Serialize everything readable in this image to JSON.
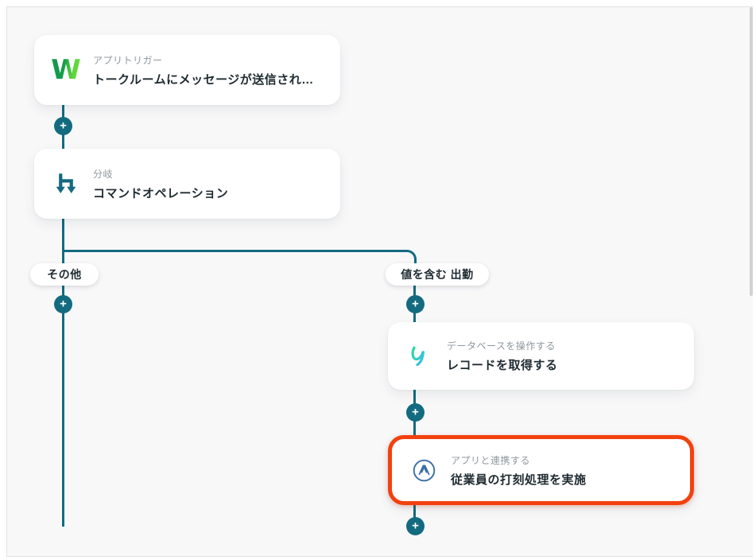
{
  "colors": {
    "accent_teal": "#136B80",
    "highlight_red": "#F2410F",
    "canvas_bg": "#F8F8F9",
    "card_bg": "#FFFFFF",
    "category_text": "#8F989D",
    "title_text": "#1F2B31"
  },
  "icons": {
    "plus": "+",
    "lineworks_glyph": "W"
  },
  "nodes": [
    {
      "icon": "lineworks-icon",
      "category": "アプリトリガー",
      "title": "トークルームにメッセージが送信され…"
    },
    {
      "icon": "branch-icon",
      "category": "分岐",
      "title": "コマンドオペレーション"
    },
    {
      "icon": "yoom-database-icon",
      "category": "データベースを操作する",
      "title": "レコードを取得する"
    },
    {
      "icon": "akashi-icon",
      "category": "アプリと連携する",
      "title": "従業員の打刻処理を実施"
    }
  ],
  "branches": [
    {
      "label": "その他"
    },
    {
      "label": "値を含む 出勤"
    }
  ]
}
